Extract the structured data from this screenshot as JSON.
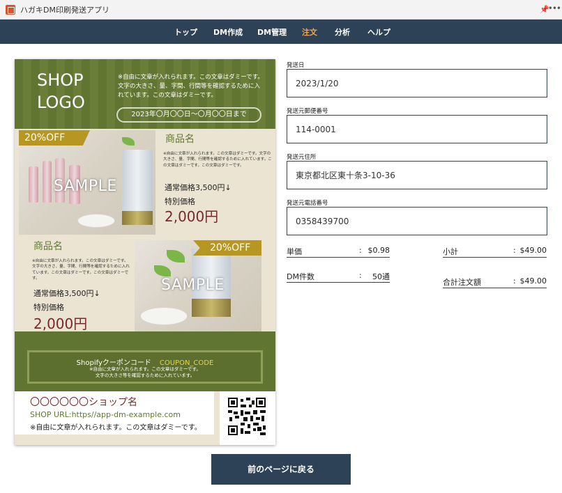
{
  "window": {
    "title": "ハガキDM印刷発送アプリ"
  },
  "nav": {
    "items": [
      {
        "label": "トップ"
      },
      {
        "label": "DM作成"
      },
      {
        "label": "DM管理"
      },
      {
        "label": "注文"
      },
      {
        "label": "分析"
      },
      {
        "label": "ヘルプ"
      }
    ],
    "active": "注文"
  },
  "flyer": {
    "shop_logo": [
      "SHOP",
      "LOGO"
    ],
    "header_text": "※自由に文章が入れられます。この文章はダミーです。文字の大きさ、量、字間、行間等を確認するために入れています。この文章はダミーです。",
    "date_range": "2023年〇月〇〇日〜〇月〇〇日まで",
    "products": [
      {
        "badge": "20%OFF",
        "name": "商品名",
        "description": "※自由に文章が入れられます。この文章はダミーです。文字の大きさ、量、字間、行間等を確認するために入れています。この文章はダミーです。この文章はダミーです。",
        "regular_price": "通常価格3,500円↓",
        "special_label": "特別価格",
        "special_price": "2,000円",
        "image_label": "SAMPLE"
      },
      {
        "badge": "20%OFF",
        "name": "商品名",
        "description": "※自由に文章が入れられます。この文章はダミーです。文字の大きさ、量、字間、行間等を確認するために入れています。この文章はダミーです。この文章はダミーです。",
        "regular_price": "通常価格3,500円↓",
        "special_label": "特別価格",
        "special_price": "2,000円",
        "image_label": "SAMPLE"
      }
    ],
    "coupon": {
      "title": "Shopifyクーポンコード",
      "code": "COUPON_CODE",
      "note_line1": "※自由に文章が入れられます。この文章はダミーです。",
      "note_line2": "文字の大きさ等を確認するために入れています。"
    },
    "shop": {
      "name": "〇〇〇〇〇〇ショップ名",
      "url": "SHOP URL:https//app-dm-example.com",
      "note": "※自由に文章が入れられます。この文章はダミーです。"
    }
  },
  "form": {
    "ship_date": {
      "label": "発送日",
      "value": "2023/1/20"
    },
    "sender_zip": {
      "label": "発送元郵便番号",
      "value": "114-0001"
    },
    "sender_address": {
      "label": "発送元住所",
      "value": "東京都北区東十条3-10-36"
    },
    "sender_phone": {
      "label": "発送元電話番号",
      "value": "0358439700"
    }
  },
  "summary": {
    "unit_price": {
      "label": "単価",
      "value": "$0.98"
    },
    "subtotal": {
      "label": "小計",
      "value": "$49.00"
    },
    "dm_count": {
      "label": "DM件数",
      "value": "50通"
    },
    "total": {
      "label": "合計注文額",
      "value": "$49.00"
    }
  },
  "back_button": {
    "label": "前のページに戻る"
  }
}
